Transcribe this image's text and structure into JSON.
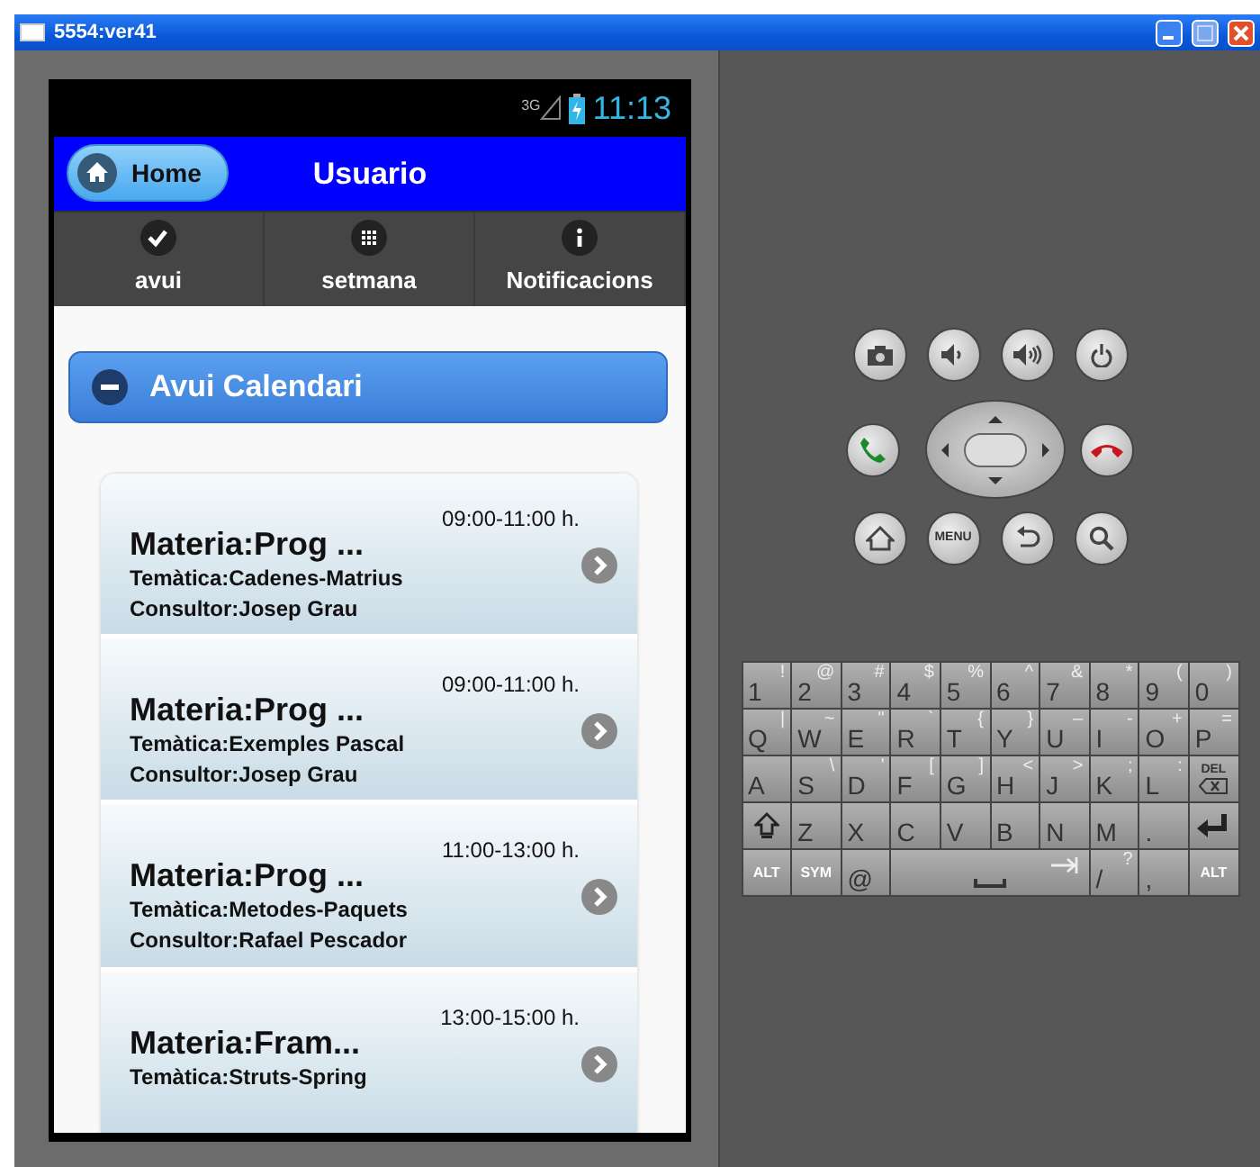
{
  "window": {
    "title": "5554:ver41"
  },
  "status_bar": {
    "network": "3G",
    "time": "11:13"
  },
  "header": {
    "home_button": "Home",
    "title": "Usuario"
  },
  "nav_tabs": [
    {
      "label": "avui",
      "selected": false
    },
    {
      "label": "setmana",
      "selected": false
    },
    {
      "label": "Notificacions",
      "selected": false
    }
  ],
  "collapsible": {
    "title": "Avui Calendari",
    "expanded": true
  },
  "sessions": [
    {
      "subject": "Materia:Prog ...",
      "time": "09:00-11:00 h.",
      "topic": "Temàtica:Cadenes-Matrius",
      "consultant": "Consultor:Josep Grau"
    },
    {
      "subject": "Materia:Prog ...",
      "time": "09:00-11:00 h.",
      "topic": "Temàtica:Exemples Pascal",
      "consultant": "Consultor:Josep Grau"
    },
    {
      "subject": "Materia:Prog ...",
      "time": "11:00-13:00 h.",
      "topic": "Temàtica:Metodes-Paquets",
      "consultant": "Consultor:Rafael Pescador"
    },
    {
      "subject": "Materia:Fram...",
      "time": "13:00-15:00 h.",
      "topic": "Temàtica:Struts-Spring"
    }
  ],
  "hardware_buttons": {
    "menu_label": "MENU"
  },
  "keyboard": {
    "rows": [
      [
        {
          "kind": "char",
          "main": "1",
          "alt": "!"
        },
        {
          "kind": "char",
          "main": "2",
          "alt": "@"
        },
        {
          "kind": "char",
          "main": "3",
          "alt": "#"
        },
        {
          "kind": "char",
          "main": "4",
          "alt": "$"
        },
        {
          "kind": "char",
          "main": "5",
          "alt": "%"
        },
        {
          "kind": "char",
          "main": "6",
          "alt": "^"
        },
        {
          "kind": "char",
          "main": "7",
          "alt": "&"
        },
        {
          "kind": "char",
          "main": "8",
          "alt": "*"
        },
        {
          "kind": "char",
          "main": "9",
          "alt": "("
        },
        {
          "kind": "char",
          "main": "0",
          "alt": ")"
        }
      ],
      [
        {
          "kind": "char",
          "main": "Q",
          "alt": "|"
        },
        {
          "kind": "char",
          "main": "W",
          "alt": "~"
        },
        {
          "kind": "char",
          "main": "E",
          "alt": "\""
        },
        {
          "kind": "char",
          "main": "R",
          "alt": "`"
        },
        {
          "kind": "char",
          "main": "T",
          "alt": "{"
        },
        {
          "kind": "char",
          "main": "Y",
          "alt": "}"
        },
        {
          "kind": "char",
          "main": "U",
          "alt": "–"
        },
        {
          "kind": "char",
          "main": "I",
          "alt": "-"
        },
        {
          "kind": "char",
          "main": "O",
          "alt": "+"
        },
        {
          "kind": "char",
          "main": "P",
          "alt": "="
        }
      ],
      [
        {
          "kind": "char",
          "main": "A"
        },
        {
          "kind": "char",
          "main": "S",
          "alt": "\\"
        },
        {
          "kind": "char",
          "main": "D",
          "alt": "'"
        },
        {
          "kind": "char",
          "main": "F",
          "alt": "["
        },
        {
          "kind": "char",
          "main": "G",
          "alt": "]"
        },
        {
          "kind": "char",
          "main": "H",
          "alt": "<"
        },
        {
          "kind": "char",
          "main": "J",
          "alt": ">"
        },
        {
          "kind": "char",
          "main": "K",
          "alt": ";"
        },
        {
          "kind": "char",
          "main": "L",
          "alt": ":"
        },
        {
          "kind": "delete",
          "main": "DEL"
        }
      ],
      [
        {
          "kind": "shift"
        },
        {
          "kind": "char",
          "main": "Z"
        },
        {
          "kind": "char",
          "main": "X"
        },
        {
          "kind": "char",
          "main": "C"
        },
        {
          "kind": "char",
          "main": "V"
        },
        {
          "kind": "char",
          "main": "B"
        },
        {
          "kind": "char",
          "main": "N"
        },
        {
          "kind": "char",
          "main": "M"
        },
        {
          "kind": "char",
          "main": "."
        },
        {
          "kind": "enter"
        }
      ]
    ],
    "bottom_row": [
      {
        "kind": "label",
        "main": "ALT"
      },
      {
        "kind": "label",
        "main": "SYM"
      },
      {
        "kind": "char",
        "main": "@"
      },
      {
        "kind": "space"
      },
      {
        "kind": "char",
        "main": "/",
        "alt": "?"
      },
      {
        "kind": "char",
        "main": ","
      },
      {
        "kind": "label",
        "main": "ALT"
      }
    ]
  }
}
